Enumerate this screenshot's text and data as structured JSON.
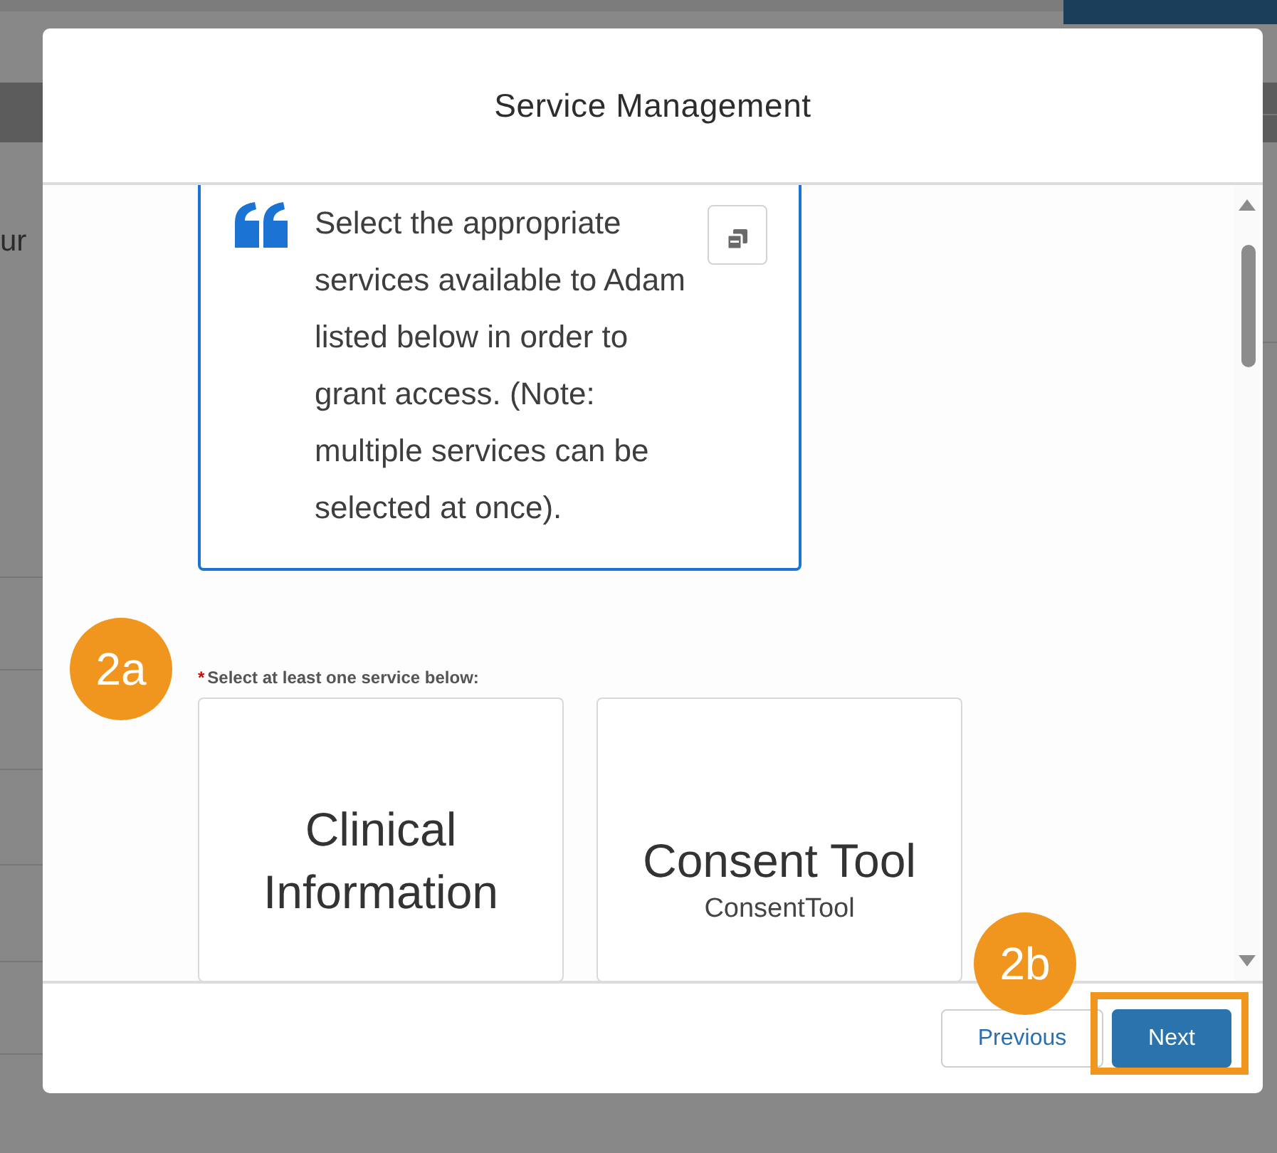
{
  "background": {
    "fragment": "ur"
  },
  "modal": {
    "title": "Service Management",
    "instructions": {
      "text": "Select the appropriate services available to Adam listed below in order to grant access. (Note: multiple services can be selected at once)."
    },
    "required_label": {
      "marker": "*",
      "text": "Select at least one service below:"
    },
    "services": [
      {
        "name": "Clinical Information"
      },
      {
        "name": "Consent Tool",
        "code": "ConsentTool"
      }
    ],
    "buttons": [
      {
        "label": "Previous",
        "kind": "neutral",
        "highlighted": false
      },
      {
        "label": "Next",
        "kind": "brand",
        "highlighted": true
      }
    ]
  },
  "annotations": [
    {
      "label": "2a"
    },
    {
      "label": "2b"
    }
  ]
}
